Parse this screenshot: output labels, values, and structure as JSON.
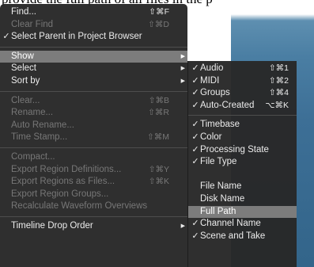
{
  "background_text": "provide the full path of all files in the p",
  "main_menu": [
    {
      "type": "item",
      "label": "Find...",
      "shortcut": "⇧⌘F",
      "enabled": true
    },
    {
      "type": "item",
      "label": "Clear Find",
      "shortcut": "⇧⌘D",
      "enabled": false
    },
    {
      "type": "item",
      "label": "Select Parent in Project Browser",
      "check": "✓",
      "enabled": true
    },
    {
      "type": "separator"
    },
    {
      "type": "item",
      "label": "Show",
      "submenu": true,
      "selected": true,
      "enabled": true
    },
    {
      "type": "item",
      "label": "Select",
      "submenu": true,
      "enabled": true
    },
    {
      "type": "item",
      "label": "Sort by",
      "submenu": true,
      "enabled": true
    },
    {
      "type": "separator"
    },
    {
      "type": "item",
      "label": "Clear...",
      "shortcut": "⇧⌘B",
      "enabled": false
    },
    {
      "type": "item",
      "label": "Rename...",
      "shortcut": "⇧⌘R",
      "enabled": false
    },
    {
      "type": "item",
      "label": "Auto Rename...",
      "enabled": false
    },
    {
      "type": "item",
      "label": "Time Stamp...",
      "shortcut": "⇧⌘M",
      "enabled": false
    },
    {
      "type": "separator"
    },
    {
      "type": "item",
      "label": "Compact...",
      "enabled": false
    },
    {
      "type": "item",
      "label": "Export Region Definitions...",
      "shortcut": "⇧⌘Y",
      "enabled": false
    },
    {
      "type": "item",
      "label": "Export Regions as Files...",
      "shortcut": "⇧⌘K",
      "enabled": false
    },
    {
      "type": "item",
      "label": "Export Region Groups...",
      "enabled": false
    },
    {
      "type": "item",
      "label": "Recalculate Waveform Overviews",
      "enabled": false
    },
    {
      "type": "separator"
    },
    {
      "type": "item",
      "label": "Timeline Drop Order",
      "submenu": true,
      "enabled": true
    }
  ],
  "show_submenu": [
    {
      "type": "item",
      "label": "Audio",
      "check": "✓",
      "shortcut": "⇧⌘1"
    },
    {
      "type": "item",
      "label": "MIDI",
      "check": "✓",
      "shortcut": "⇧⌘2"
    },
    {
      "type": "item",
      "label": "Groups",
      "check": "✓",
      "shortcut": "⇧⌘4"
    },
    {
      "type": "item",
      "label": "Auto-Created",
      "check": "✓",
      "shortcut": "⌥⌘K"
    },
    {
      "type": "separator"
    },
    {
      "type": "item",
      "label": "Timebase",
      "check": "✓"
    },
    {
      "type": "item",
      "label": "Color",
      "check": "✓"
    },
    {
      "type": "item",
      "label": "Processing State",
      "check": "✓"
    },
    {
      "type": "item",
      "label": "File Type",
      "check": "✓"
    },
    {
      "type": "blank"
    },
    {
      "type": "item",
      "label": "File Name"
    },
    {
      "type": "item",
      "label": "Disk Name"
    },
    {
      "type": "item",
      "label": "Full Path",
      "selected": true
    },
    {
      "type": "item",
      "label": "Channel Name",
      "check": "✓"
    },
    {
      "type": "item",
      "label": "Scene and Take",
      "check": "✓"
    }
  ]
}
